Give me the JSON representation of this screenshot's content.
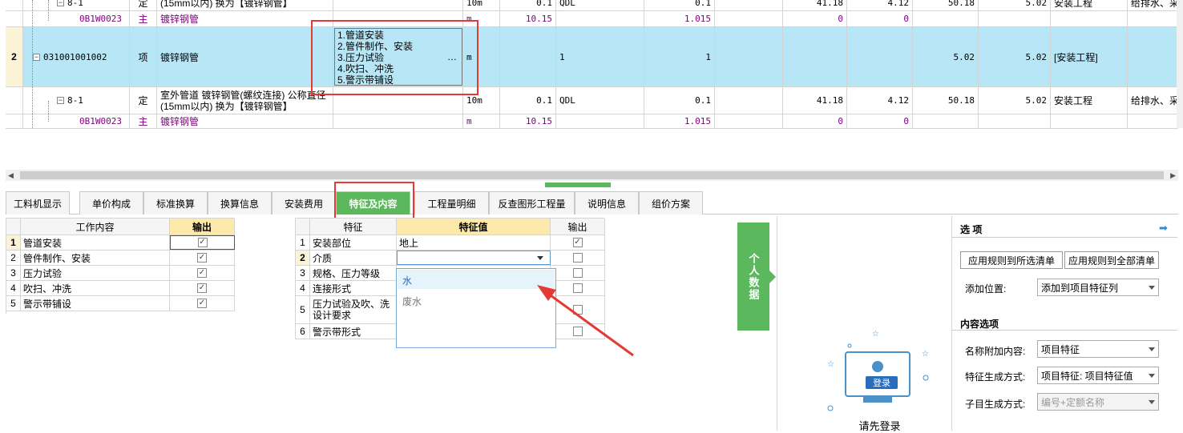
{
  "grid": {
    "row0": {
      "code": "8-1",
      "type": "定",
      "name": "(15mm以内) 换为【镀锌钢管】",
      "unit": "10m",
      "qty": "0.1",
      "qdl": "QDL",
      "qty2": "0.1",
      "p1": "41.18",
      "p2": "4.12",
      "p3": "50.18",
      "p4": "5.02",
      "cat": "安装工程",
      "extra": "给排水、采"
    },
    "row1": {
      "code": "0B1W0023",
      "type": "主",
      "name": "镀锌钢管",
      "unit": "m",
      "qty": "10.15",
      "qty2": "1.015",
      "a": "0",
      "b": "0"
    },
    "row2": {
      "num": "2",
      "code": "031001001002",
      "type": "项",
      "name": "镀锌钢管",
      "features": [
        "1.管道安装",
        "2.管件制作、安装",
        "3.压力试验",
        "4.吹扫、冲洗",
        "5.警示带铺设"
      ],
      "more": "…",
      "unit": "m",
      "qty": "1",
      "qty2": "1",
      "p3": "5.02",
      "p4": "5.02",
      "cat": "[安装工程]"
    },
    "row3": {
      "code": "8-1",
      "type": "定",
      "name1": "室外管道 镀锌钢管(螺纹连接) 公称直径",
      "name2": "(15mm以内) 换为【镀锌钢管】",
      "unit": "10m",
      "qty": "0.1",
      "qdl": "QDL",
      "qty2": "0.1",
      "p1": "41.18",
      "p2": "4.12",
      "p3": "50.18",
      "p4": "5.02",
      "cat": "安装工程",
      "extra": "给排水、采暖"
    },
    "row4": {
      "code": "0B1W0023",
      "type": "主",
      "name": "镀锌钢管",
      "unit": "m",
      "qty": "10.15",
      "qty2": "1.015",
      "a": "0",
      "b": "0"
    }
  },
  "tabs": [
    "工料机显示",
    "单价构成",
    "标准换算",
    "换算信息",
    "安装费用",
    "特征及内容",
    "工程量明细",
    "反查图形工程量",
    "说明信息",
    "组价方案"
  ],
  "work": {
    "header": {
      "content": "工作内容",
      "output": "输出"
    },
    "rows": [
      {
        "n": "1",
        "t": "管道安装"
      },
      {
        "n": "2",
        "t": "管件制作、安装"
      },
      {
        "n": "3",
        "t": "压力试验"
      },
      {
        "n": "4",
        "t": "吹扫、冲洗"
      },
      {
        "n": "5",
        "t": "警示带铺设"
      }
    ]
  },
  "feature": {
    "header": {
      "name": "特征",
      "value": "特征值",
      "output": "输出"
    },
    "rows": [
      {
        "n": "1",
        "t": "安装部位",
        "v": "地上",
        "checked": true
      },
      {
        "n": "2",
        "t": "介质",
        "v": "",
        "checked": false
      },
      {
        "n": "3",
        "t": "规格、压力等级",
        "v": "",
        "checked": false
      },
      {
        "n": "4",
        "t": "连接形式",
        "v": "",
        "checked": false
      },
      {
        "n": "5",
        "t1": "压力试验及吹、洗",
        "t2": "设计要求",
        "v": "",
        "checked": false
      },
      {
        "n": "6",
        "t": "警示带形式",
        "v": "",
        "checked": false
      }
    ],
    "dropdown": [
      "水",
      "废水"
    ]
  },
  "personal": {
    "label": "个人数据",
    "login_button": "登录",
    "login_prompt": "请先登录"
  },
  "options": {
    "title": "选 项",
    "btn_selected": "应用规则到所选清单",
    "btn_all": "应用规则到全部清单",
    "add_pos_label": "添加位置:",
    "add_pos_value": "添加到项目特征列",
    "content_title": "内容选项",
    "name_add_label": "名称附加内容:",
    "name_add_value": "项目特征",
    "feature_gen_label": "特征生成方式:",
    "feature_gen_value": "项目特征: 项目特征值",
    "child_gen_label": "子目生成方式:",
    "child_gen_value": "编号+定额名称"
  },
  "colors": {
    "accent": "#5cb85c",
    "selected_row": "#b7e6f7",
    "highlight_box": "#e53935",
    "header_yellow": "#fde9a9"
  }
}
